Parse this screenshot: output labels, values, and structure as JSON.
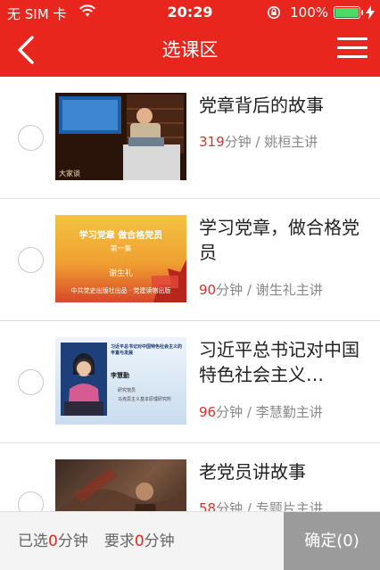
{
  "status_bar": {
    "carrier": "无 SIM 卡",
    "time": "20:29",
    "battery": "100%",
    "battery_level": 1.0
  },
  "nav": {
    "title": "选课区",
    "back_icon": "chevron-left-icon",
    "menu_icon": "hamburger-menu-icon"
  },
  "courses": [
    {
      "title": "党章背后的故事",
      "minutes": "319",
      "unit": "分钟",
      "lecturer": " / 姚桓主讲"
    },
    {
      "title": "学习党章，做合格党员",
      "minutes": "90",
      "unit": "分钟",
      "lecturer": " / 谢生礼主讲"
    },
    {
      "title": "习近平总书记对中国特色社会主义…",
      "minutes": "96",
      "unit": "分钟",
      "lecturer": " / 李慧勤主讲"
    },
    {
      "title": "老党员讲故事",
      "minutes": "58",
      "unit": "分钟",
      "lecturer": " / 专题片主讲"
    }
  ],
  "thumbnails": {
    "t1_caption": "大家谈",
    "t2_line1": "学习党章  做合格党员",
    "t2_line2": "第一集",
    "t2_line3": "谢生礼",
    "t2_line4": "中共党史出版社出品 · 党建读物出版",
    "t3_header": "习近平总书记对中国特色社会主义的丰富与发展",
    "t3_name": "李慧勤",
    "t3_sub1": "研究馆员",
    "t3_sub2": "马克思主义基本原理研究所"
  },
  "footer": {
    "selected_prefix": "已选",
    "selected_value": "0",
    "selected_unit": "分钟",
    "required_prefix": "要求",
    "required_value": "0",
    "required_unit": "分钟",
    "confirm_label": "确定(0)"
  },
  "colors": {
    "brand_red": "#e8261d",
    "accent_red": "#d8322a",
    "confirm_gray": "#9b9b9b"
  }
}
